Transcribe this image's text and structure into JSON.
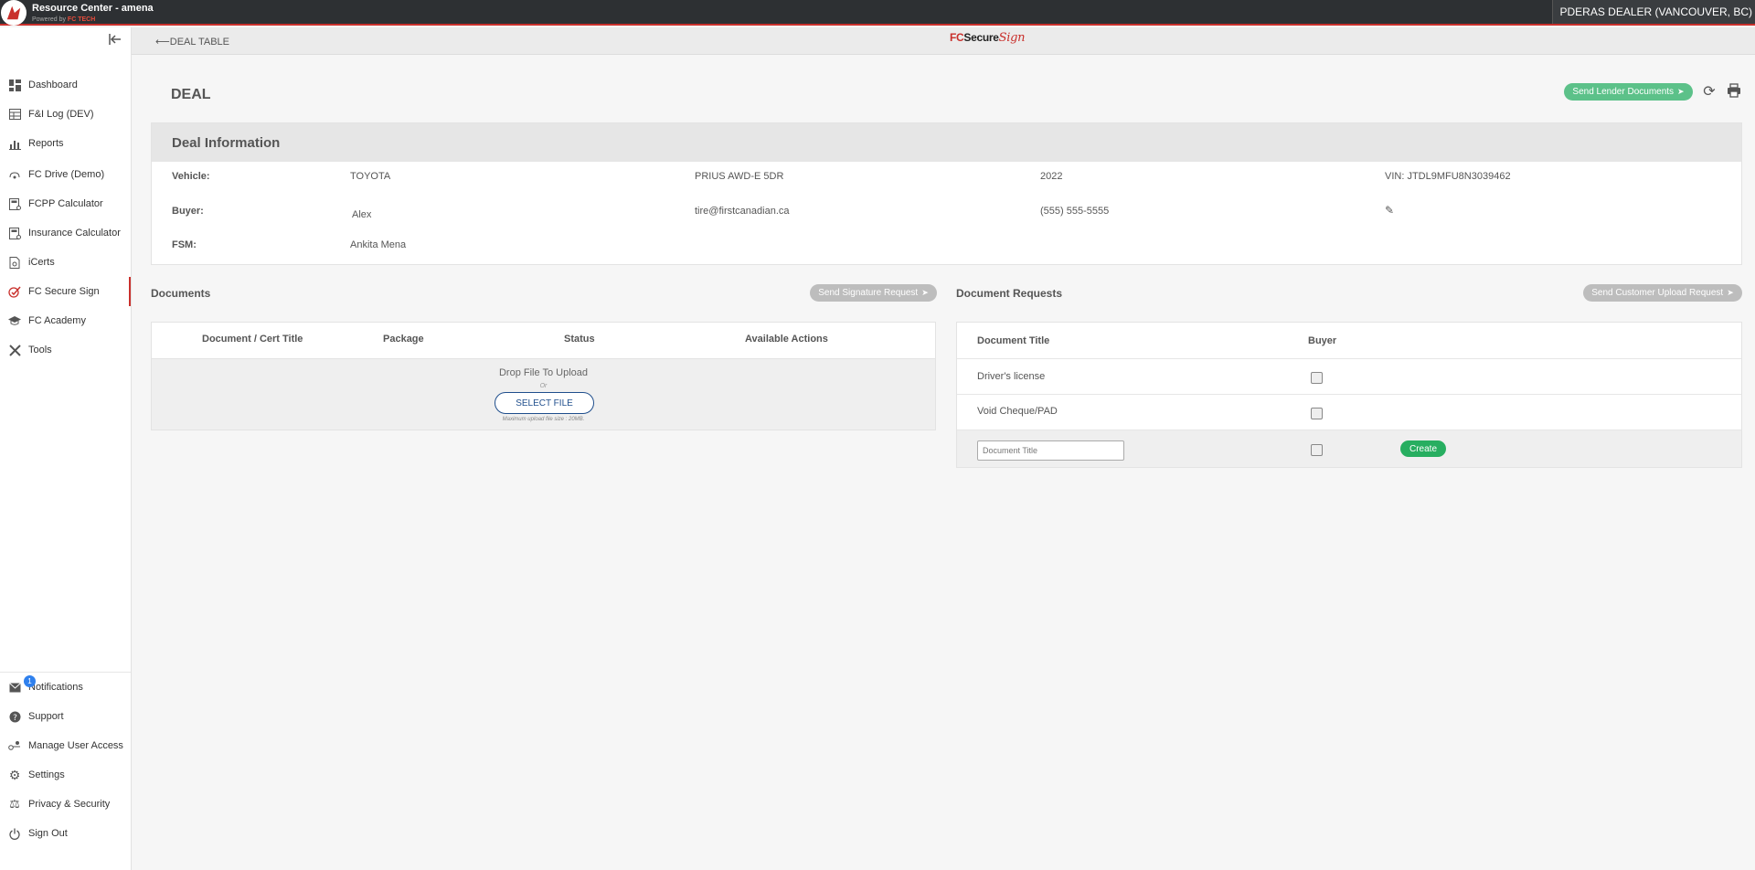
{
  "topbar": {
    "title": "Resource Center - amena",
    "powered_by": "Powered by",
    "powered_brand": "FC TECH",
    "dealer": "PDERAS DEALER (VANCOUVER, BC)"
  },
  "sidebar": {
    "items": [
      {
        "label": "Dashboard",
        "icon": "dashboard-icon"
      },
      {
        "label": "F&I Log (DEV)",
        "icon": "table-icon"
      },
      {
        "label": "Reports",
        "icon": "chart-icon"
      },
      {
        "label": "FC Drive (Demo)",
        "icon": "drive-icon"
      },
      {
        "label": "FCPP Calculator",
        "icon": "calculator-icon"
      },
      {
        "label": "Insurance Calculator",
        "icon": "calculator-icon"
      },
      {
        "label": "iCerts",
        "icon": "certificate-icon"
      },
      {
        "label": "FC Secure Sign",
        "icon": "secure-sign-icon"
      },
      {
        "label": "FC Academy",
        "icon": "graduation-cap-icon"
      },
      {
        "label": "Tools",
        "icon": "tools-icon"
      }
    ],
    "bottom_items": [
      {
        "label": "Notifications",
        "icon": "mail-icon",
        "badge": "1"
      },
      {
        "label": "Support",
        "icon": "question-icon"
      },
      {
        "label": "Manage User Access",
        "icon": "user-access-icon"
      },
      {
        "label": "Settings",
        "icon": "gear-icon"
      },
      {
        "label": "Privacy & Security",
        "icon": "scale-icon"
      },
      {
        "label": "Sign Out",
        "icon": "power-icon"
      }
    ]
  },
  "header": {
    "back_label": "DEAL TABLE",
    "logo_fc": "FC",
    "logo_secure": "Secure",
    "logo_sign": "Sign"
  },
  "deal": {
    "title": "DEAL",
    "send_lender_label": "Send Lender Documents",
    "info_title": "Deal Information",
    "vehicle_label": "Vehicle:",
    "vehicle_make": "TOYOTA",
    "vehicle_model": "PRIUS AWD-E 5DR",
    "vehicle_year": "2022",
    "vin": "VIN: JTDL9MFU8N3039462",
    "buyer_label": "Buyer:",
    "buyer_name": "Alex",
    "buyer_email": "tire@firstcanadian.ca",
    "buyer_phone": "(555) 555-5555",
    "fsm_label": "FSM:",
    "fsm_name": "Ankita Mena"
  },
  "documents": {
    "title": "Documents",
    "send_signature_label": "Send Signature Request",
    "columns": [
      "Document / Cert Title",
      "Package",
      "Status",
      "Available Actions"
    ],
    "drop_text": "Drop File To Upload",
    "or_text": "Or",
    "select_label": "SELECT FILE",
    "max_text": "Maximum upload file size : 20MB."
  },
  "requests": {
    "title": "Document Requests",
    "send_upload_label": "Send Customer Upload Request",
    "columns": [
      "Document Title",
      "Buyer"
    ],
    "rows": [
      {
        "title": "Driver's license"
      },
      {
        "title": "Void Cheque/PAD"
      }
    ],
    "input_placeholder": "Document Title",
    "create_label": "Create"
  },
  "colors": {
    "accent_red": "#c9302c",
    "green": "#5cc189",
    "create_green": "#27ae60",
    "select_blue": "#1f4e8c"
  }
}
